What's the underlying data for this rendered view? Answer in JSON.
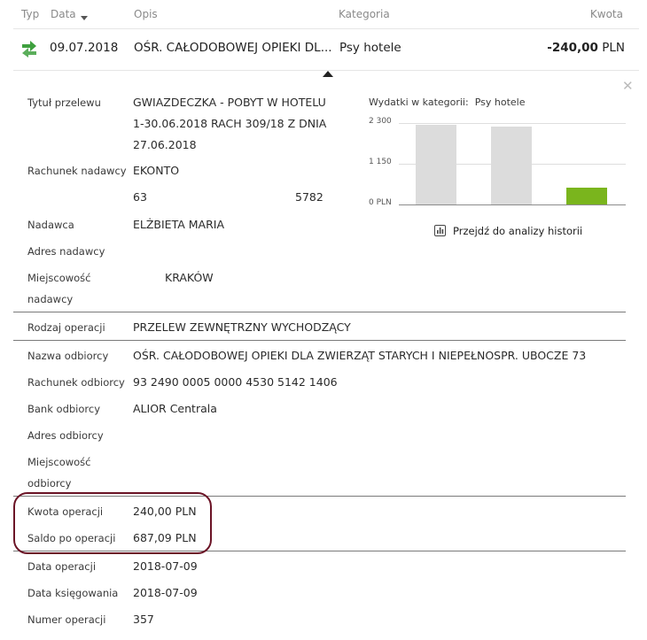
{
  "header": {
    "col_type": "Typ",
    "col_date": "Data",
    "col_desc": "Opis",
    "col_category": "Kategoria",
    "col_amount": "Kwota"
  },
  "transaction": {
    "icon": "transfer-arrows-icon",
    "icon_color": "#3ea03e",
    "date": "09.07.2018",
    "description": "OŚR. CAŁODOBOWEJ OPIEKI DL...",
    "category": "Psy hotele",
    "amount": "-240,00",
    "currency": "PLN"
  },
  "details": {
    "title": {
      "label": "Tytuł przelewu",
      "lines": [
        "GWIAZDECZKA - POBYT W HOTELU",
        "1-30.06.2018 RACH 309/18 Z DNIA",
        "27.06.2018"
      ]
    },
    "sender_account": {
      "label": "Rachunek nadawcy",
      "name": "EKONTO",
      "number_start": "63",
      "number_end": "5782"
    },
    "sender": {
      "label": "Nadawca",
      "value": "ELŻBIETA MARIA"
    },
    "sender_address": {
      "label": "Adres nadawcy",
      "value": ""
    },
    "sender_city": {
      "label_1": "Miejscowość",
      "label_2": "nadawcy",
      "value": "KRAKÓW"
    },
    "operation_type": {
      "label": "Rodzaj operacji",
      "value": "PRZELEW ZEWNĘTRZNY WYCHODZĄCY"
    },
    "recipient_name": {
      "label": "Nazwa odbiorcy",
      "value": "OŚR. CAŁODOBOWEJ OPIEKI DLA ZWIERZĄT STARYCH I NIEPEŁNOSPR. UBOCZE 73"
    },
    "recipient_account": {
      "label": "Rachunek odbiorcy",
      "value": "93 2490 0005 0000 4530 5142 1406"
    },
    "recipient_bank": {
      "label": "Bank odbiorcy",
      "value": "ALIOR Centrala"
    },
    "recipient_address": {
      "label": "Adres odbiorcy",
      "value": ""
    },
    "recipient_city": {
      "label_1": "Miejscowość",
      "label_2": "odbiorcy",
      "value": ""
    },
    "operation_amount": {
      "label": "Kwota operacji",
      "value": "240,00 PLN"
    },
    "balance_after": {
      "label": "Saldo po operacji",
      "value": "687,09 PLN"
    },
    "operation_date": {
      "label": "Data operacji",
      "value": "2018-07-09"
    },
    "booking_date": {
      "label": "Data księgowania",
      "value": "2018-07-09"
    },
    "operation_number": {
      "label": "Numer operacji",
      "value": "357"
    }
  },
  "chart_data": {
    "type": "bar",
    "title": "Wydatki w kategorii:",
    "category": "Psy hotele",
    "ytick_labels": [
      "2 300",
      "1 150",
      "0 PLN"
    ],
    "ytick_values": [
      2300,
      1150,
      0
    ],
    "ylim": [
      0,
      2300
    ],
    "values": [
      2240,
      2190,
      480
    ],
    "colors": [
      "#dcdcdc",
      "#dcdcdc",
      "#7ab51d"
    ]
  },
  "history_link": {
    "icon": "bar-chart-icon",
    "label": "Przejdź do analizy historii"
  },
  "close_icon": "close-icon"
}
